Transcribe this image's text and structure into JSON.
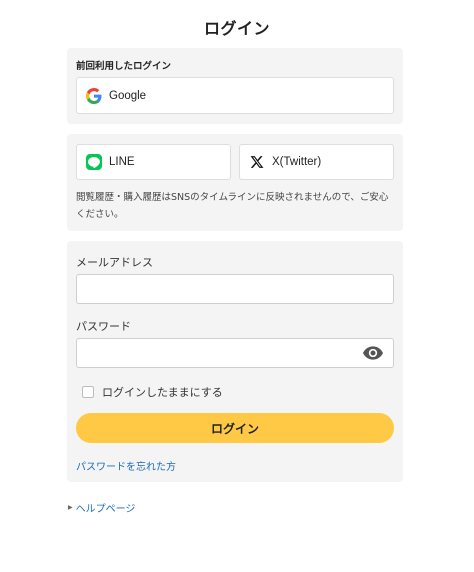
{
  "page": {
    "title": "ログイン"
  },
  "last_used": {
    "label": "前回利用したログイン",
    "google_label": "Google"
  },
  "sns": {
    "line_label": "LINE",
    "x_label": "X(Twitter)",
    "note": "閲覧履歴・購入履歴はSNSのタイムラインに反映されませんので、ご安心ください。"
  },
  "form": {
    "email_label": "メールアドレス",
    "email_value": "",
    "password_label": "パスワード",
    "password_value": "",
    "remember_label": "ログインしたままにする",
    "remember_checked": false,
    "submit_label": "ログイン",
    "forgot_label": "パスワードを忘れた方"
  },
  "footer": {
    "help_label": "ヘルプページ"
  },
  "colors": {
    "accent": "#ffc845",
    "link": "#1a6bb8",
    "line_green": "#06c755",
    "panel_bg": "#f4f4f4"
  },
  "icons": [
    "google-icon",
    "line-icon",
    "x-icon",
    "eye-icon",
    "triangle-right-icon"
  ]
}
